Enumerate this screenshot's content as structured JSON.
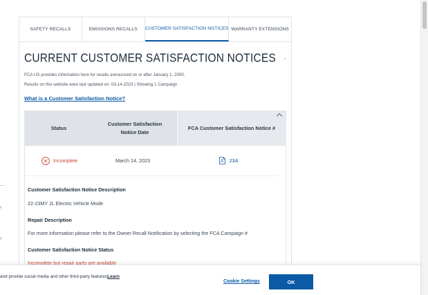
{
  "tabs": [
    {
      "label": "SAFETY RECALLS",
      "active": false
    },
    {
      "label": "EMISSIONS RECALLS",
      "active": false
    },
    {
      "label": "CUSTOMER SATISFACTION NOTICES",
      "active": true
    },
    {
      "label": "WARRANTY EXTENSIONS",
      "active": false
    }
  ],
  "main": {
    "title": "CURRENT CUSTOMER SATISFACTION NOTICES",
    "info_line_1": "FCA US provides information here for recalls announced on or after January 1, 2000.",
    "info_line_2": "Results on this website were last updated on: 03-14-2023 | Showing 1 Campaign",
    "help_link": "What is a Customer Satisfaction Notice?"
  },
  "table": {
    "headers": {
      "status": "Status",
      "date_line1": "Customer Satisfaction",
      "date_line2": "Notice Date",
      "number": "FCA Customer Satisfaction Notice #"
    },
    "row": {
      "status": "Incomplete",
      "date": "March 14, 2023",
      "campaign": "23A"
    }
  },
  "details": {
    "description_label": "Customer Satisfaction Notice Description",
    "description_value": "22-23MY JL Electric Vehicle Mode",
    "repair_label": "Repair Description",
    "repair_value": "For more information please refer to the Owner Recall Notification by selecting the FCA Campaign #",
    "status_label": "Customer Satisfaction Notice Status",
    "status_value": "Incomplete but repair parts are available"
  },
  "cookie": {
    "text": "and provide social media and other third-party features.",
    "learn": "Learn",
    "settings": "Cookie Settings",
    "ok": "OK"
  },
  "colors": {
    "accent": "#0b5aa6",
    "status_red": "#c9473a",
    "header_bg": "#dfe3e7"
  },
  "icons": {
    "status": "circle-x-icon",
    "campaign": "pdf-icon",
    "expand": "chevron-up-icon"
  }
}
